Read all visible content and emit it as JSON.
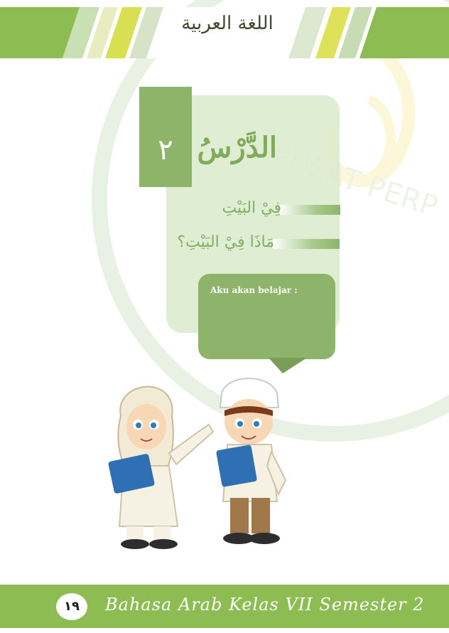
{
  "header": {
    "title": "اللغة العربية"
  },
  "lesson": {
    "number": "٢",
    "label": "الدَّرْسُ"
  },
  "topics": [
    "فِيْ البَيْتِ",
    "مَاذَا فِيْ البَيْتِ؟"
  ],
  "bubble": {
    "text": "Aku akan belajar  :"
  },
  "footer": {
    "page_number": "١٩",
    "text": "Bahasa Arab Kelas VII Semester 2"
  },
  "watermark": {
    "text": "PUSAT PERP"
  },
  "colors": {
    "primary_green": "#8cbc52",
    "panel_green": "#d9eacb",
    "box_green": "#8eb46a"
  }
}
